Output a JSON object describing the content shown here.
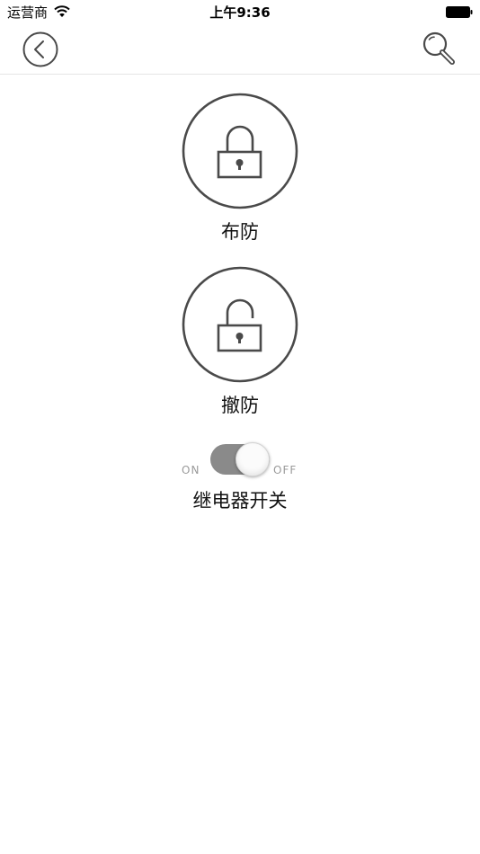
{
  "status_bar": {
    "carrier": "运营商",
    "time": "上午9:36"
  },
  "nav": {
    "back_icon": "chevron-left-circle-icon",
    "search_icon": "magnifier-icon"
  },
  "arm": {
    "label": "布防",
    "icon": "lock-closed-icon"
  },
  "disarm": {
    "label": "撤防",
    "icon": "lock-open-icon"
  },
  "relay": {
    "label": "继电器开关",
    "on_text": "ON",
    "off_text": "OFF",
    "state": "off"
  },
  "colors": {
    "icon_stroke": "#4a4a4a",
    "toggle_track": "#8a8a8a",
    "divider": "#e6e6e6"
  }
}
